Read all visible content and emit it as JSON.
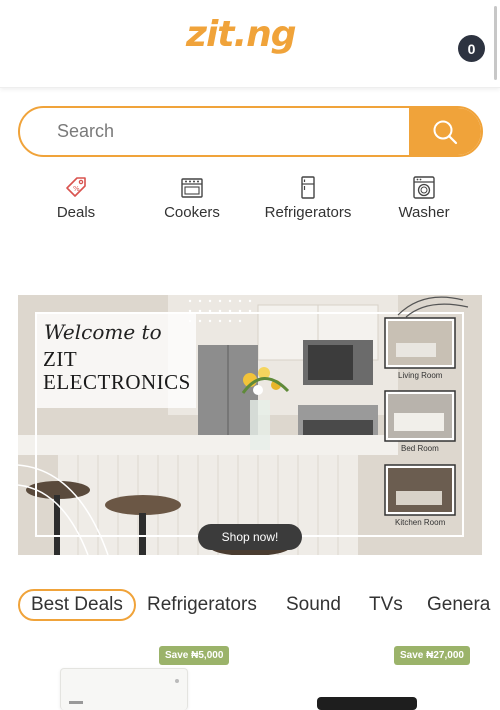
{
  "header": {
    "logo": "zit.ng",
    "cart_count": "0"
  },
  "search": {
    "placeholder": "Search"
  },
  "categories": [
    {
      "label": "Deals",
      "icon": "tag-icon"
    },
    {
      "label": "Cookers",
      "icon": "cooker-icon"
    },
    {
      "label": "Refrigerators",
      "icon": "refrigerator-icon"
    },
    {
      "label": "Washer",
      "icon": "washing-machine-icon"
    }
  ],
  "banner": {
    "welcome": "Welcome to",
    "brand_line1": "ZIT",
    "brand_line2": "ELECTRONICS",
    "rooms": [
      "Living Room",
      "Bed Room",
      "Kitchen Room"
    ],
    "cta": "Shop now!"
  },
  "tabs": [
    "Best Deals",
    "Refrigerators",
    "Sound",
    "TVs",
    "Genera"
  ],
  "products": [
    {
      "badge": "Save ₦5,000"
    },
    {
      "badge": "Save ₦27,000"
    }
  ],
  "colors": {
    "accent": "#f0a33a",
    "badge": "#9bb36a",
    "cart": "#2d3340"
  }
}
